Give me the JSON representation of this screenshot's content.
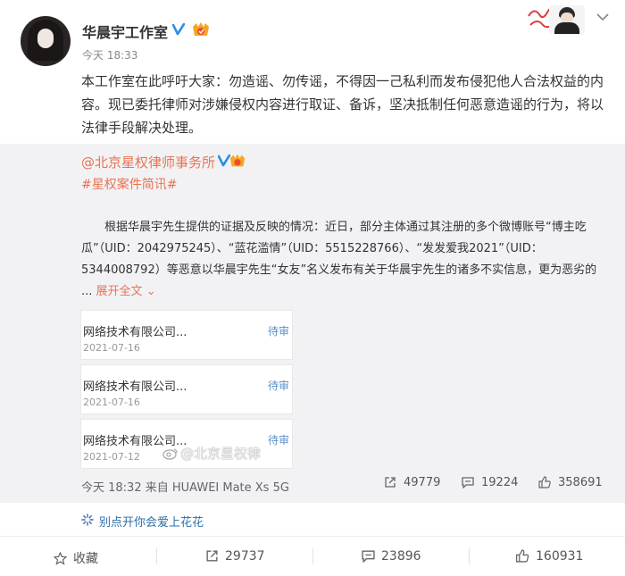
{
  "post": {
    "username": "华晨宇工作室",
    "timestamp": "今天 18:33",
    "text": "本工作室在此呼吁大家：勿造谣、勿传谣，不得因一己私利而发布侵犯他人合法权益的内容。现已委托律师对涉嫌侵权内容进行取证、备诉，坚决抵制任何恶意造谣的行为，将以法律手段解决处理。"
  },
  "repost": {
    "author": "@北京星权律师事务所",
    "topic": "#星权案件简讯#",
    "text": "根据华晨宇先生提供的证据及反映的情况：近日，部分主体通过其注册的多个微博账号“博主吃瓜”（UID：2042975245）、“蓝花滥情”（UID：5515228766）、“发发爱我2021”（UID：5344008792）等恶意以华晨宇先生“女友”名义发布有关于华晨宇先生的诸多不实信息，更为恶劣的 ...",
    "expand": "展开全文",
    "cards": [
      {
        "title": "网络技术有限公司...",
        "date": "2021-07-16",
        "status": "待审"
      },
      {
        "title": "网络技术有限公司...",
        "date": "2021-07-16",
        "status": "待审"
      },
      {
        "title": "网络技术有限公司...",
        "date": "2021-07-12",
        "status": "待审"
      }
    ],
    "watermark": "@北京星权律",
    "footer_time": "今天 18:32 来自 HUAWEI Mate Xs 5G",
    "reposts": "49779",
    "comments": "19224",
    "likes": "358691"
  },
  "comment_hint": "别点开你会爱上花花",
  "toolbar": {
    "favorite": "收藏",
    "reposts": "29737",
    "comments": "23896",
    "likes": "160931"
  },
  "colors": {
    "accent": "#eb7350",
    "link": "#2e6ea6",
    "repost_bg": "#f2f2f5"
  }
}
